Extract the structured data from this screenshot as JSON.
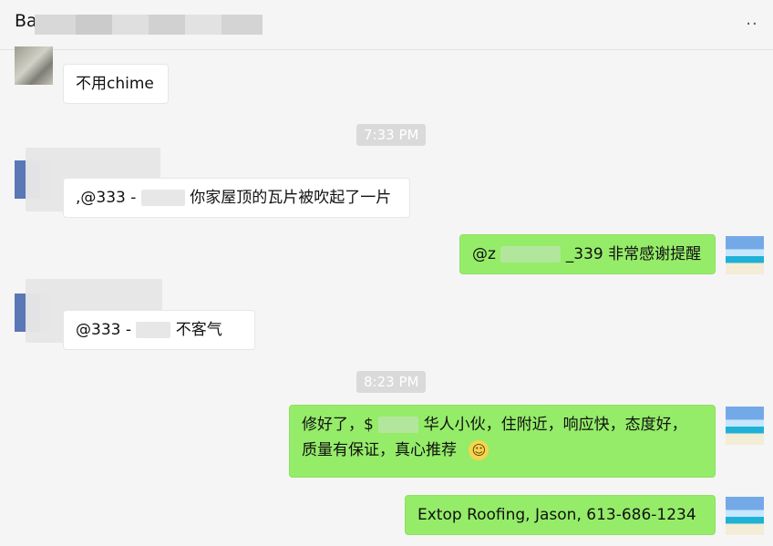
{
  "chat": {
    "title_prefix": "Ba",
    "more_icon": "more-icon"
  },
  "messages": {
    "m1": "不用chime",
    "ts1": "7:33 PM",
    "m2_a": ",@333 - ",
    "m2_b": "你家屋顶的瓦片被吹起了一片",
    "m3_a": "@z",
    "m3_b": "_339 非常感谢提醒",
    "m4_a": "@333 - ",
    "m4_b": "不客气",
    "ts2": "8:23 PM",
    "m5_line1": "修好了，$",
    "m5_line1_b": "华人小伙，住附近，响应快，态度好，",
    "m5_line2": "质量有保证，真心推荐",
    "m6": "Extop Roofing, Jason, 613-686-1234"
  },
  "icons": {
    "smile": "smiley-emoji-icon"
  }
}
